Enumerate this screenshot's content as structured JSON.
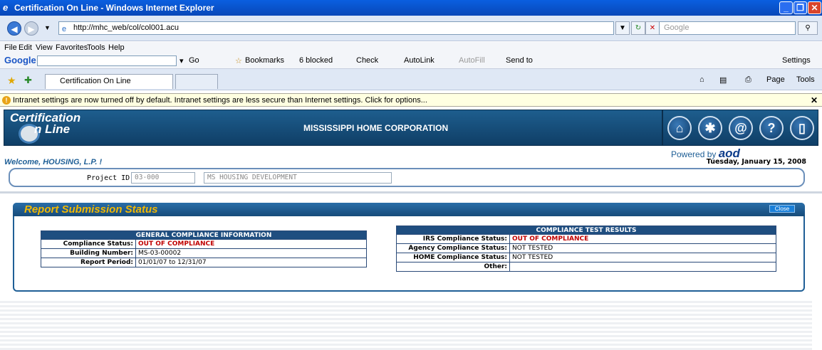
{
  "browser": {
    "title": "Certification On Line - Windows Internet Explorer",
    "url": "http://mhc_web/col/col001.acu",
    "search_placeholder": "Google",
    "menu": [
      "File",
      "Edit",
      "View",
      "Favorites",
      "Tools",
      "Help"
    ],
    "google_toolbar": {
      "go": "Go",
      "bookmarks": "Bookmarks",
      "blocked": "6 blocked",
      "check": "Check",
      "autolink": "AutoLink",
      "autofill": "AutoFill",
      "sendto": "Send to",
      "settings": "Settings"
    },
    "tab_label": "Certification On Line",
    "page_menu": "Page",
    "tools_menu": "Tools",
    "infobar": "Intranet settings are now turned off by default. Intranet settings are less secure than Internet settings. Click for options..."
  },
  "app": {
    "logo_line1": "Certification",
    "logo_line2": "n Line",
    "org": "MISSISSIPPI HOME CORPORATION",
    "powered_by": "Powered by",
    "powered_brand": "aod",
    "welcome": "Welcome, HOUSING, L.P. !",
    "date": "Tuesday, January 15, 2008",
    "project_label": "Project ID:",
    "project_id": "03-000",
    "project_name": "MS HOUSING DEVELOPMENT"
  },
  "report": {
    "title": "Report Submission Status",
    "close": "Close",
    "general": {
      "heading": "GENERAL COMPLIANCE INFORMATION",
      "rows": [
        {
          "label": "Compliance Status:",
          "value": "OUT OF COMPLIANCE"
        },
        {
          "label": "Building Number:",
          "value": "MS-03-00002"
        },
        {
          "label": "Report Period:",
          "value": "01/01/07 to 12/31/07"
        }
      ]
    },
    "tests": {
      "heading": "COMPLIANCE TEST RESULTS",
      "rows": [
        {
          "label": "IRS Compliance Status:",
          "value": "OUT OF COMPLIANCE"
        },
        {
          "label": "Agency Compliance Status:",
          "value": "NOT TESTED"
        },
        {
          "label": "HOME Compliance Status:",
          "value": "NOT TESTED"
        },
        {
          "label": "Other:",
          "value": ""
        }
      ]
    }
  }
}
